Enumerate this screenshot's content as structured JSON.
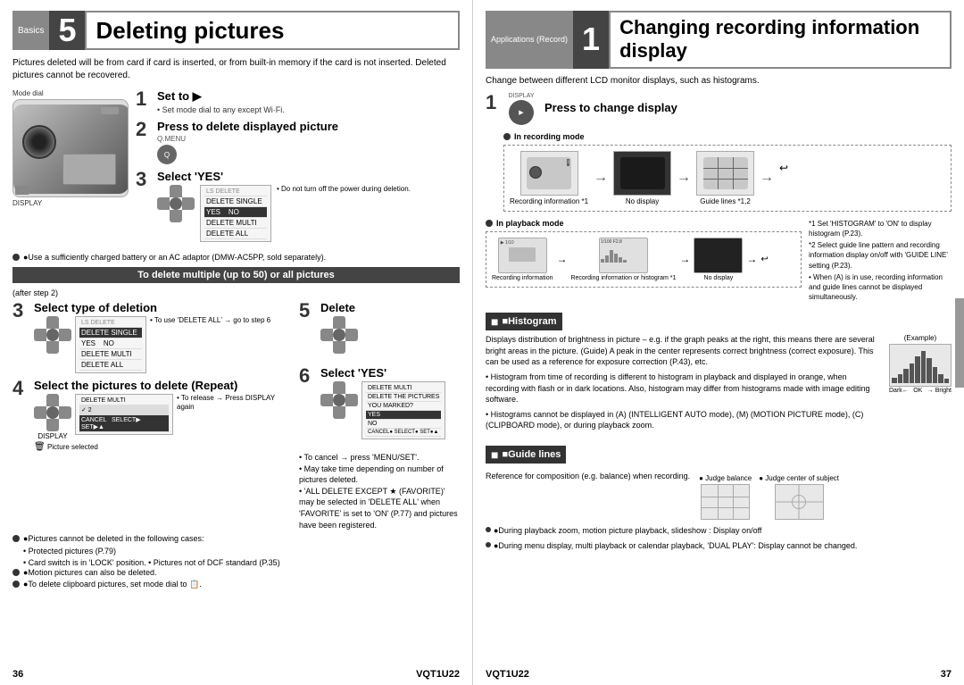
{
  "left": {
    "header": {
      "label": "Basics",
      "number": "5",
      "title": "Deleting pictures"
    },
    "intro": "Pictures deleted will be from card if card is inserted, or from built-in memory if the card is not inserted. Deleted pictures cannot be recovered.",
    "camera_labels": {
      "mode_dial": "Mode dial",
      "display": "DISPLAY"
    },
    "step1": {
      "number": "1",
      "title": "Set to ▶",
      "desc": "• Set mode dial to any except Wi·Fi."
    },
    "step2": {
      "number": "2",
      "title": "Press to delete displayed picture",
      "sublabel": "Q.MENU"
    },
    "step3": {
      "number": "3",
      "title": "Select 'YES'",
      "note": "• Do not turn off the power during deletion."
    },
    "note1": "●Use a sufficiently charged battery or an AC adaptor (DMW-AC5PP, sold separately).",
    "dark_banner": "To delete multiple (up to 50) or all pictures",
    "after_step": "(after step 2)",
    "step3b": {
      "number": "3",
      "title": "Select type of deletion",
      "note": "• To use 'DELETE ALL' → go to step 6"
    },
    "step4": {
      "number": "4",
      "title": "Select the pictures to delete (Repeat)",
      "note": "• To release → Press DISPLAY again",
      "sublabel": "DISPLAY",
      "pic_selected": "Picture selected"
    },
    "step5": {
      "number": "5",
      "title": "Delete"
    },
    "step6": {
      "number": "6",
      "title": "Select 'YES'"
    },
    "notes_bottom": [
      "• To cancel → press 'MENU/SET'.",
      "• May take time depending on number of pictures deleted.",
      "• 'ALL DELETE EXCEPT ★ (FAVORITE)' may be selected in 'DELETE ALL' when 'FAVORITE' is set to 'ON' (P.77) and pictures have been registered."
    ],
    "bottom_bullets": [
      "●Pictures cannot be deleted in the following cases:",
      "• Protected pictures (P.79)",
      "• Card switch is in 'LOCK' position. • Pictures not of DCF standard (P.35)",
      "●Motion pictures can also be deleted.",
      "●To delete clipboard pictures, set mode dial to 📋."
    ],
    "page_number": "36",
    "page_code": "VQT1U22",
    "delete_menu": {
      "items": [
        "DELETE SINGLE",
        "YES NO",
        "DELETE MULTI",
        "DELETE ALL"
      ]
    }
  },
  "right": {
    "header": {
      "label": "Applications\n(Record)",
      "number": "1",
      "title": "Changing recording information display"
    },
    "intro": "Change between different LCD monitor displays, such as histograms.",
    "step1": {
      "number": "1",
      "display_label": "DISPLAY",
      "title": "Press to change display"
    },
    "recording_label": "In recording mode",
    "recording_sublabels": {
      "info": "Recording\ninformation *1",
      "no_display": "No display",
      "guide_lines": "Guide lines *1,2"
    },
    "playback_label": "In playback mode",
    "playback_sublabels": {
      "info": "Recording\ninformation",
      "histogram": "Recording information\nor histogram *1",
      "no_display": "No display"
    },
    "footnotes": [
      "*1 Set 'HISTOGRAM' to 'ON' to display histogram (P.23).",
      "*2 Select guide line pattern and recording information display on/off with 'GUIDE LINE' setting (P.23).",
      "• When (A) is in use, recording information and guide lines cannot be displayed simultaneously."
    ],
    "histogram_section": {
      "title": "■Histogram",
      "example_label": "(Example)",
      "desc": "Displays distribution of brightness in picture\n– e.g. if the graph peaks at the right, this means there are several bright areas in the picture. (Guide) A peak in the center represents correct brightness (correct exposure). This can be used as a reference for exposure correction (P.43), etc.",
      "bullet1": "• Histogram from time of recording is different to histogram in playback and displayed in orange, when recording with flash or in dark locations. Also, histogram may differ from histograms made with image editing software.",
      "bullet2": "• Histograms cannot be displayed in (A) (INTELLIGENT AUTO mode), (M) (MOTION PICTURE mode), (C) (CLIPBOARD mode), or during playback zoom.",
      "dark_label": "Dark←",
      "ok_label": "OK",
      "bright_label": "→ Bright"
    },
    "guide_section": {
      "title": "■Guide lines",
      "ref_label": "Reference for composition\n(e.g. balance) when recording.",
      "judge_balance": "● Judge balance",
      "judge_center": "● Judge center of subject"
    },
    "bottom_bullets": [
      "●During playback zoom, motion picture playback, slideshow : Display on/off",
      "●During menu display, multi playback or calendar playback, 'DUAL PLAY': Display cannot be changed."
    ],
    "page_number": "37",
    "page_code": "VQT1U22"
  }
}
